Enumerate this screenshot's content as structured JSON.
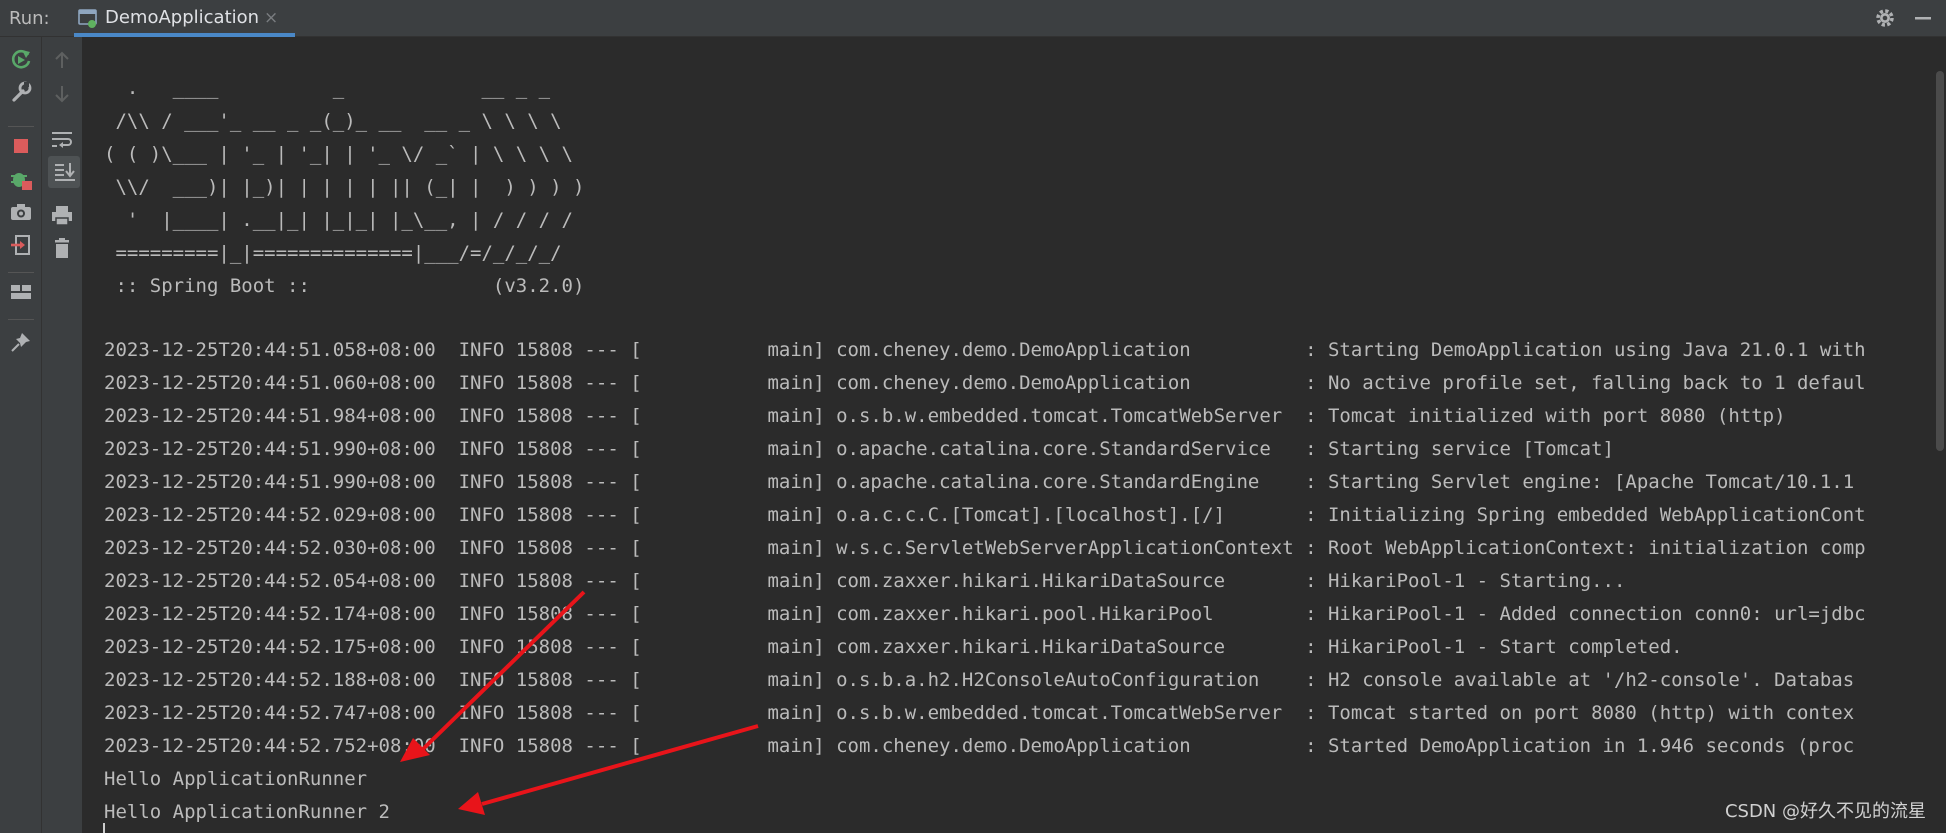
{
  "tabbar": {
    "run_label": "Run:",
    "tab_label": "DemoApplication",
    "close_glyph": "×",
    "right_icons": [
      "gear-icon",
      "minimize-icon"
    ]
  },
  "toolbar": {
    "primary": [
      "rerun-icon",
      "wrench-icon",
      "stop-icon",
      "debug-icon",
      "camera-icon",
      "login-icon",
      "layout-icon",
      "pin-icon"
    ],
    "secondary": [
      "up-arrow-icon",
      "down-arrow-icon",
      "soft-wrap-icon",
      "scroll-to-end-icon",
      "print-icon",
      "trash-icon"
    ]
  },
  "console": {
    "banner": [
      "  .   ____          _            __ _ _",
      " /\\\\ / ___'_ __ _ _(_)_ __  __ _ \\ \\ \\ \\",
      "( ( )\\___ | '_ | '_| | '_ \\/ _` | \\ \\ \\ \\",
      " \\\\/  ___)| |_)| | | | | || (_| |  ) ) ) )",
      "  '  |____| .__|_| |_|_| |_\\__, | / / / /",
      " =========|_|==============|___/=/_/_/_/",
      " :: Spring Boot ::                (v3.2.0)"
    ],
    "logs": [
      "2023-12-25T20:44:51.058+08:00  INFO 15808 --- [           main] com.cheney.demo.DemoApplication          : Starting DemoApplication using Java 21.0.1 with",
      "2023-12-25T20:44:51.060+08:00  INFO 15808 --- [           main] com.cheney.demo.DemoApplication          : No active profile set, falling back to 1 defaul",
      "2023-12-25T20:44:51.984+08:00  INFO 15808 --- [           main] o.s.b.w.embedded.tomcat.TomcatWebServer  : Tomcat initialized with port 8080 (http)",
      "2023-12-25T20:44:51.990+08:00  INFO 15808 --- [           main] o.apache.catalina.core.StandardService   : Starting service [Tomcat]",
      "2023-12-25T20:44:51.990+08:00  INFO 15808 --- [           main] o.apache.catalina.core.StandardEngine    : Starting Servlet engine: [Apache Tomcat/10.1.1",
      "2023-12-25T20:44:52.029+08:00  INFO 15808 --- [           main] o.a.c.c.C.[Tomcat].[localhost].[/]       : Initializing Spring embedded WebApplicationCont",
      "2023-12-25T20:44:52.030+08:00  INFO 15808 --- [           main] w.s.c.ServletWebServerApplicationContext : Root WebApplicationContext: initialization comp",
      "2023-12-25T20:44:52.054+08:00  INFO 15808 --- [           main] com.zaxxer.hikari.HikariDataSource       : HikariPool-1 - Starting...",
      "2023-12-25T20:44:52.174+08:00  INFO 15808 --- [           main] com.zaxxer.hikari.pool.HikariPool        : HikariPool-1 - Added connection conn0: url=jdbc",
      "2023-12-25T20:44:52.175+08:00  INFO 15808 --- [           main] com.zaxxer.hikari.HikariDataSource       : HikariPool-1 - Start completed.",
      "2023-12-25T20:44:52.188+08:00  INFO 15808 --- [           main] o.s.b.a.h2.H2ConsoleAutoConfiguration    : H2 console available at '/h2-console'. Databas",
      "2023-12-25T20:44:52.747+08:00  INFO 15808 --- [           main] o.s.b.w.embedded.tomcat.TomcatWebServer  : Tomcat started on port 8080 (http) with contex",
      "2023-12-25T20:44:52.752+08:00  INFO 15808 --- [           main] com.cheney.demo.DemoApplication          : Started DemoApplication in 1.946 seconds (proc"
    ],
    "output": [
      "Hello ApplicationRunner",
      "Hello ApplicationRunner 2"
    ]
  },
  "watermark": "CSDN @好久不见的流星",
  "colors": {
    "background": "#2b2b2b",
    "panel": "#3c3f41",
    "text": "#bbbbbb",
    "accent": "#4a88c7",
    "arrow": "#e8141a"
  }
}
